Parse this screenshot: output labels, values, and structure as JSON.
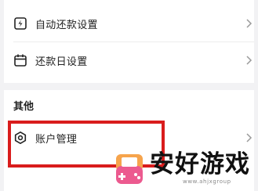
{
  "settings": {
    "items": [
      {
        "label": "自动还款设置",
        "icon": "auto-repay-icon"
      },
      {
        "label": "还款日设置",
        "icon": "calendar-icon"
      }
    ]
  },
  "other": {
    "title": "其他",
    "items": [
      {
        "label": "账户管理",
        "icon": "hexagon-gear-icon"
      }
    ]
  },
  "watermark": {
    "brand": "安好游戏",
    "site": "www.ahjxgroup"
  },
  "colors": {
    "background": "#f2f2f4",
    "card": "#ffffff",
    "highlight": "#d91c1c",
    "text": "#222222"
  }
}
